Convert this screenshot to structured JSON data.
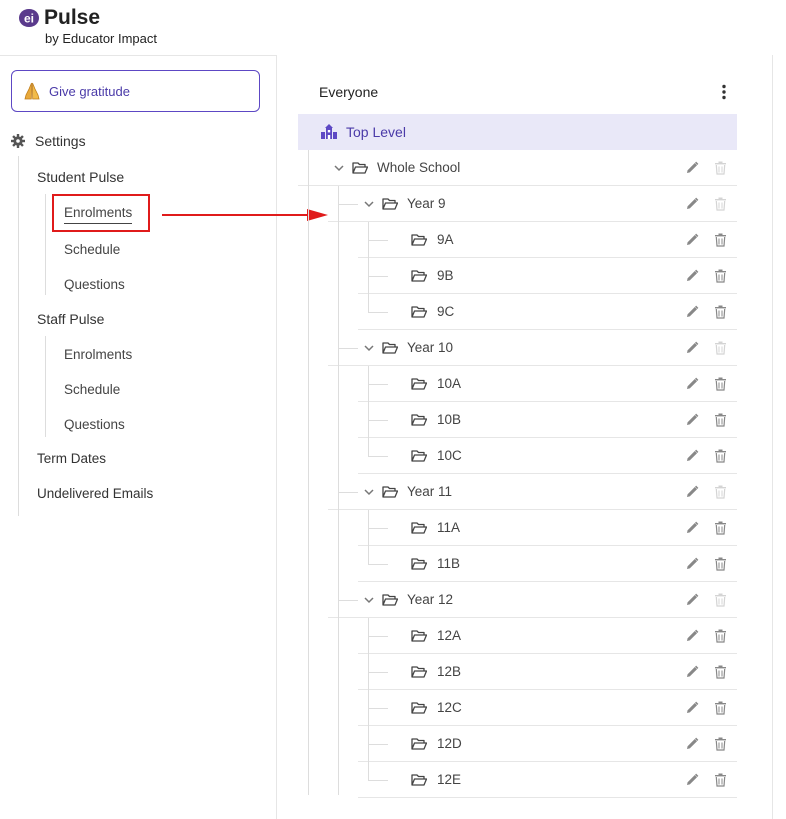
{
  "brand": {
    "logo_text": "ei",
    "app_name": "Pulse",
    "subtitle": "by Educator Impact"
  },
  "sidebar": {
    "gratitude_label": "Give gratitude",
    "settings_label": "Settings",
    "student_pulse": {
      "title": "Student Pulse",
      "items": [
        "Enrolments",
        "Schedule",
        "Questions"
      ],
      "active": "Enrolments"
    },
    "staff_pulse": {
      "title": "Staff Pulse",
      "items": [
        "Enrolments",
        "Schedule",
        "Questions"
      ]
    },
    "term_dates": "Term Dates",
    "undelivered_emails": "Undelivered Emails"
  },
  "main": {
    "group_title": "Everyone",
    "top_level_label": "Top Level",
    "tree": [
      {
        "label": "Whole School",
        "level": 0,
        "expanded": true,
        "deletable": false
      },
      {
        "label": "Year 9",
        "level": 1,
        "expanded": true,
        "deletable": false
      },
      {
        "label": "9A",
        "level": 2,
        "deletable": true
      },
      {
        "label": "9B",
        "level": 2,
        "deletable": true
      },
      {
        "label": "9C",
        "level": 2,
        "deletable": true
      },
      {
        "label": "Year 10",
        "level": 1,
        "expanded": true,
        "deletable": false
      },
      {
        "label": "10A",
        "level": 2,
        "deletable": true
      },
      {
        "label": "10B",
        "level": 2,
        "deletable": true
      },
      {
        "label": "10C",
        "level": 2,
        "deletable": true
      },
      {
        "label": "Year 11",
        "level": 1,
        "expanded": true,
        "deletable": false
      },
      {
        "label": "11A",
        "level": 2,
        "deletable": true
      },
      {
        "label": "11B",
        "level": 2,
        "deletable": true
      },
      {
        "label": "Year 12",
        "level": 1,
        "expanded": true,
        "deletable": false
      },
      {
        "label": "12A",
        "level": 2,
        "deletable": true
      },
      {
        "label": "12B",
        "level": 2,
        "deletable": true
      },
      {
        "label": "12C",
        "level": 2,
        "deletable": true
      },
      {
        "label": "12D",
        "level": 2,
        "deletable": true
      },
      {
        "label": "12E",
        "level": 2,
        "deletable": true
      }
    ]
  },
  "annotation": {
    "highlight_color": "#e01b1b",
    "target": "Enrolments"
  },
  "colors": {
    "accent": "#4a3aa8",
    "accent_bg": "#e9e8f8",
    "icon_gray": "#777777",
    "icon_disabled": "#cfcfcf"
  }
}
